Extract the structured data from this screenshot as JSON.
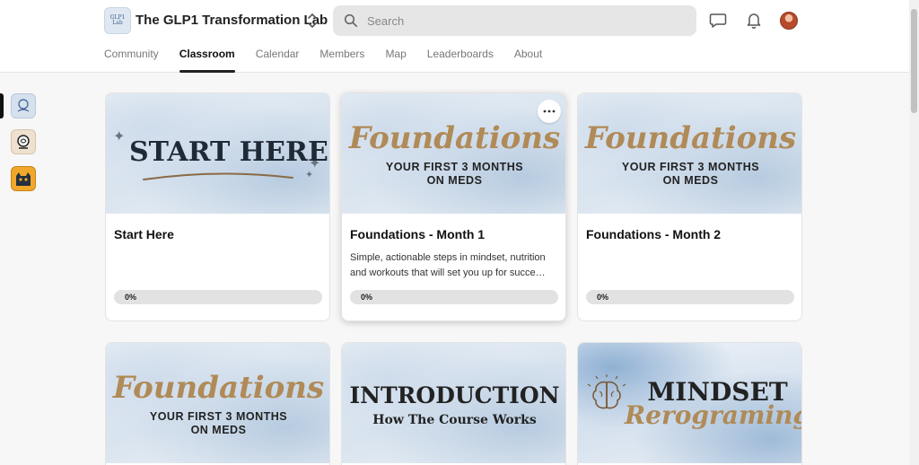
{
  "header": {
    "group_name": "The GLP1 Transformation Lab",
    "logo_text": "GLP1 Lab",
    "search_placeholder": "Search"
  },
  "nav": {
    "tabs": [
      {
        "label": "Community",
        "active": false
      },
      {
        "label": "Classroom",
        "active": true
      },
      {
        "label": "Calendar",
        "active": false
      },
      {
        "label": "Members",
        "active": false
      },
      {
        "label": "Map",
        "active": false
      },
      {
        "label": "Leaderboards",
        "active": false
      },
      {
        "label": "About",
        "active": false
      }
    ]
  },
  "courses": [
    {
      "title": "Start Here",
      "description": "",
      "progress_label": "0%",
      "progress": 0,
      "cover": {
        "line1": "START HERE"
      }
    },
    {
      "title": "Foundations - Month 1",
      "description": "Simple, actionable steps in mindset, nutrition and workouts that will set you up for succe…",
      "progress_label": "0%",
      "progress": 0,
      "cover": {
        "script": "Foundations",
        "sub1": "YOUR FIRST 3 MONTHS",
        "sub2": "ON MEDS"
      }
    },
    {
      "title": "Foundations - Month 2",
      "description": "",
      "progress_label": "0%",
      "progress": 0,
      "cover": {
        "script": "Foundations",
        "sub1": "YOUR FIRST 3 MONTHS",
        "sub2": "ON MEDS"
      }
    },
    {
      "cover": {
        "script": "Foundations",
        "sub1": "YOUR FIRST 3 MONTHS",
        "sub2": "ON MEDS"
      }
    },
    {
      "cover": {
        "line1": "INTRODUCTION",
        "line2": "How The Course Works"
      }
    },
    {
      "cover": {
        "line1": "MINDSET",
        "script": "Rerograming"
      }
    }
  ],
  "colors": {
    "accent_gold": "#b08a57",
    "progress_track": "#e2e2e2",
    "active_tab": "#222222"
  }
}
